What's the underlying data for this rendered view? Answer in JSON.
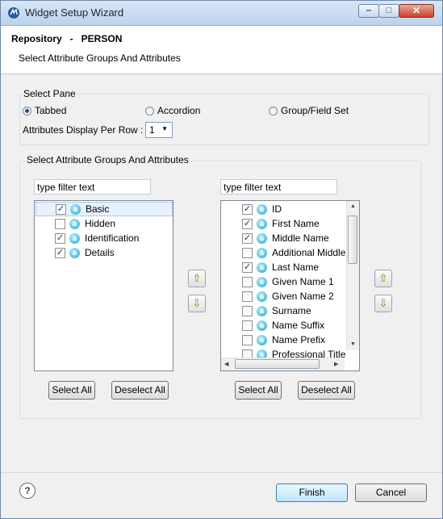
{
  "window": {
    "title": "Widget Setup Wizard",
    "minimize": "‒",
    "maximize": "□",
    "close": "✕"
  },
  "header": {
    "title": "Repository   -   PERSON",
    "description": "Select Attribute Groups And Attributes"
  },
  "select_pane": {
    "legend": "Select Pane",
    "options": [
      {
        "label": "Tabbed",
        "selected": true
      },
      {
        "label": "Accordion",
        "selected": false
      },
      {
        "label": "Group/Field Set",
        "selected": false
      }
    ],
    "per_row_label": "Attributes Display Per Row :",
    "per_row_value": "1"
  },
  "groups_section": {
    "legend": "Select Attribute Groups And Attributes",
    "left": {
      "filter_text": "type filter text",
      "items": [
        {
          "label": "Basic",
          "checked": true,
          "selected": true
        },
        {
          "label": "Hidden",
          "checked": false,
          "selected": false
        },
        {
          "label": "Identification",
          "checked": true,
          "selected": false
        },
        {
          "label": "Details",
          "checked": true,
          "selected": false
        }
      ],
      "select_all": "Select All",
      "deselect_all": "Deselect All"
    },
    "right": {
      "filter_text": "type filter text",
      "items": [
        {
          "label": "ID",
          "checked": true
        },
        {
          "label": "First Name",
          "checked": true
        },
        {
          "label": "Middle Name",
          "checked": true
        },
        {
          "label": "Additional Middle",
          "checked": false
        },
        {
          "label": "Last Name",
          "checked": true
        },
        {
          "label": "Given Name 1",
          "checked": false
        },
        {
          "label": "Given Name 2",
          "checked": false
        },
        {
          "label": "Surname",
          "checked": false
        },
        {
          "label": "Name Suffix",
          "checked": false
        },
        {
          "label": "Name Prefix",
          "checked": false
        },
        {
          "label": "Professional Title",
          "checked": false
        }
      ],
      "select_all": "Select All",
      "deselect_all": "Deselect All"
    },
    "move_up": "⇧",
    "move_down": "⇩"
  },
  "footer": {
    "help": "?",
    "finish": "Finish",
    "cancel": "Cancel"
  }
}
